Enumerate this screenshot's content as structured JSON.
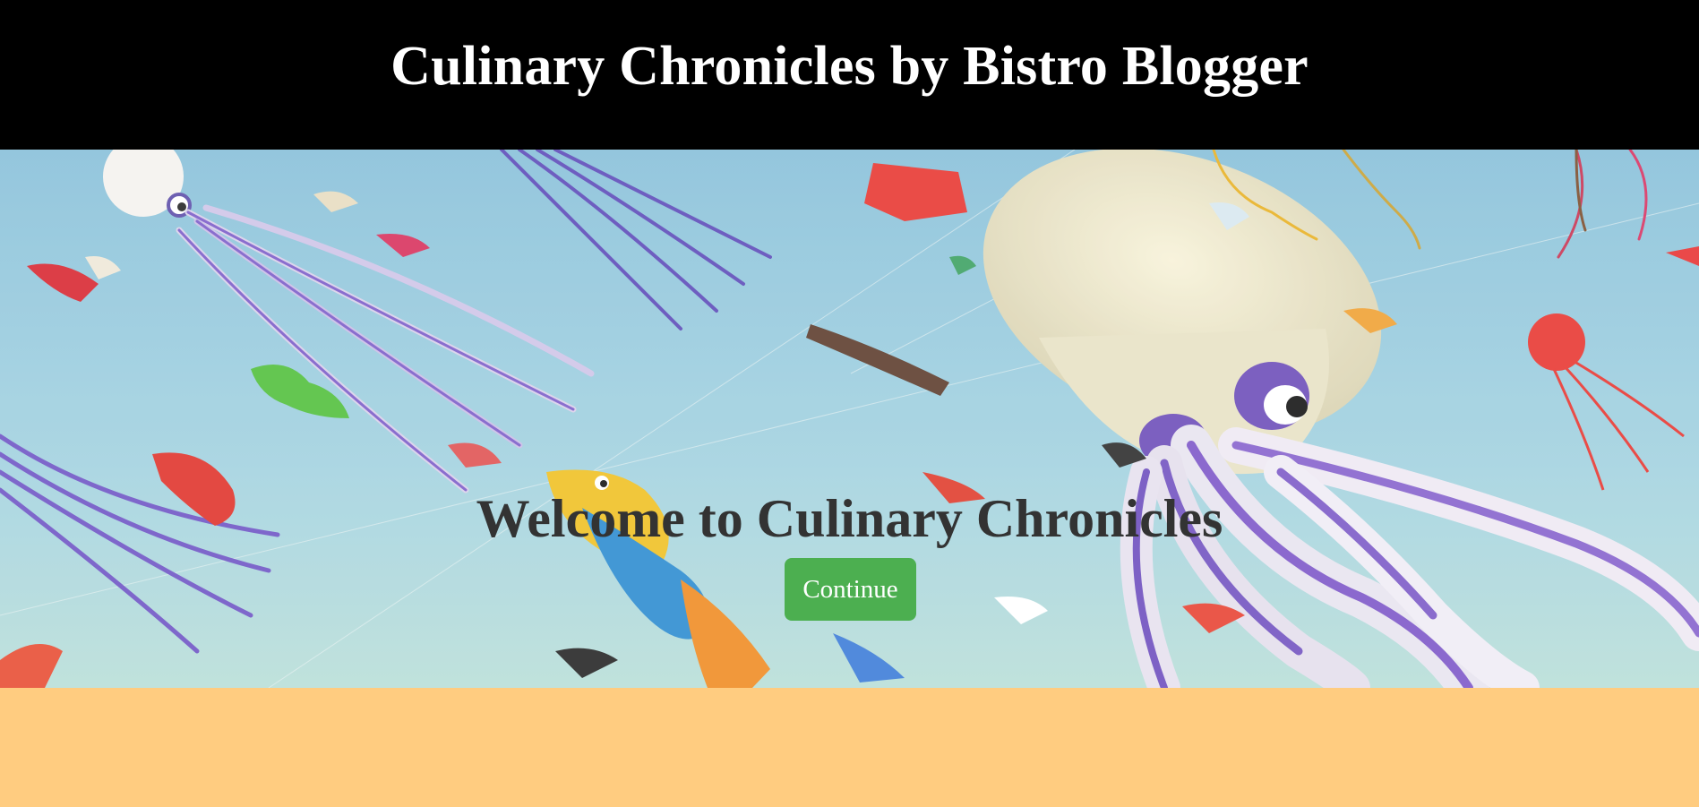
{
  "header": {
    "title": "Culinary Chronicles by Bistro Blogger"
  },
  "hero": {
    "title": "Welcome to Culinary Chronicles",
    "button_label": "Continue",
    "background_image": "kites-festival-photo"
  },
  "colors": {
    "header_bg": "#000000",
    "header_text": "#ffffff",
    "hero_title": "#333333",
    "button_bg": "#4caf50",
    "button_text": "#ffffff",
    "page_bg": "#ffcc80"
  }
}
